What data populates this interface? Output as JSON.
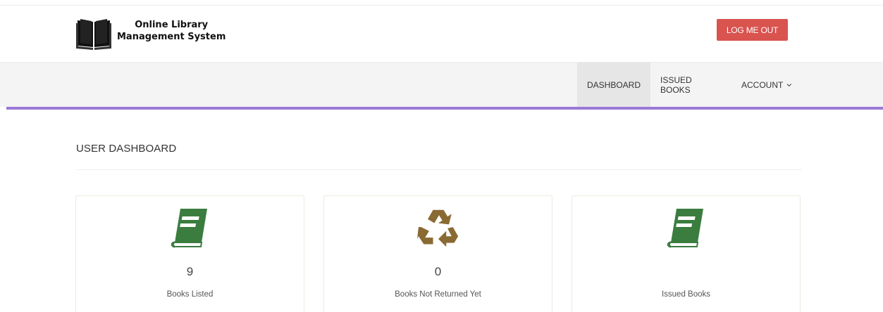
{
  "header": {
    "title_line1": "Online Library",
    "title_line2": "Management System",
    "logout_label": "LOG ME OUT"
  },
  "nav": {
    "items": [
      {
        "label": "DASHBOARD",
        "active": true
      },
      {
        "label": "ISSUED BOOKS",
        "active": false
      },
      {
        "label": "ACCOUNT",
        "active": false
      }
    ]
  },
  "page": {
    "title": "USER DASHBOARD"
  },
  "cards": [
    {
      "count": "9",
      "label": "Books Listed",
      "icon": "book-icon"
    },
    {
      "count": "0",
      "label": "Books Not Returned Yet",
      "icon": "recycle-icon"
    },
    {
      "count": "",
      "label": "Issued Books",
      "icon": "book-icon"
    }
  ],
  "colors": {
    "logout": "#d9534f",
    "nav_accent": "#9b78d8",
    "book_green": "#3a7d3f",
    "recycle_brown": "#8a6a33"
  }
}
